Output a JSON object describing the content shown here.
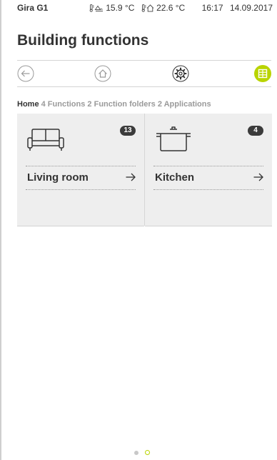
{
  "status_bar": {
    "device_name": "Gira G1",
    "outdoor_temp": "15.9 °C",
    "indoor_temp": "22.6 °C",
    "time": "16:17",
    "date": "14.09.2017"
  },
  "page_title": "Building functions",
  "nav": {
    "icons": [
      "back-arrow-icon",
      "home-icon",
      "settings-gear-icon",
      "tile-grid-icon"
    ],
    "accent_color": "#b9d400"
  },
  "breadcrumb": {
    "home": "Home",
    "functions": "4 Functions",
    "function_folders": "2 Function folders",
    "applications": "2 Applications"
  },
  "tiles": [
    {
      "label": "Living room",
      "count": "13",
      "icon": "sofa-icon"
    },
    {
      "label": "Kitchen",
      "count": "4",
      "icon": "cooking-pot-icon"
    }
  ],
  "pagination": {
    "pages": 2,
    "active_page": 2
  }
}
